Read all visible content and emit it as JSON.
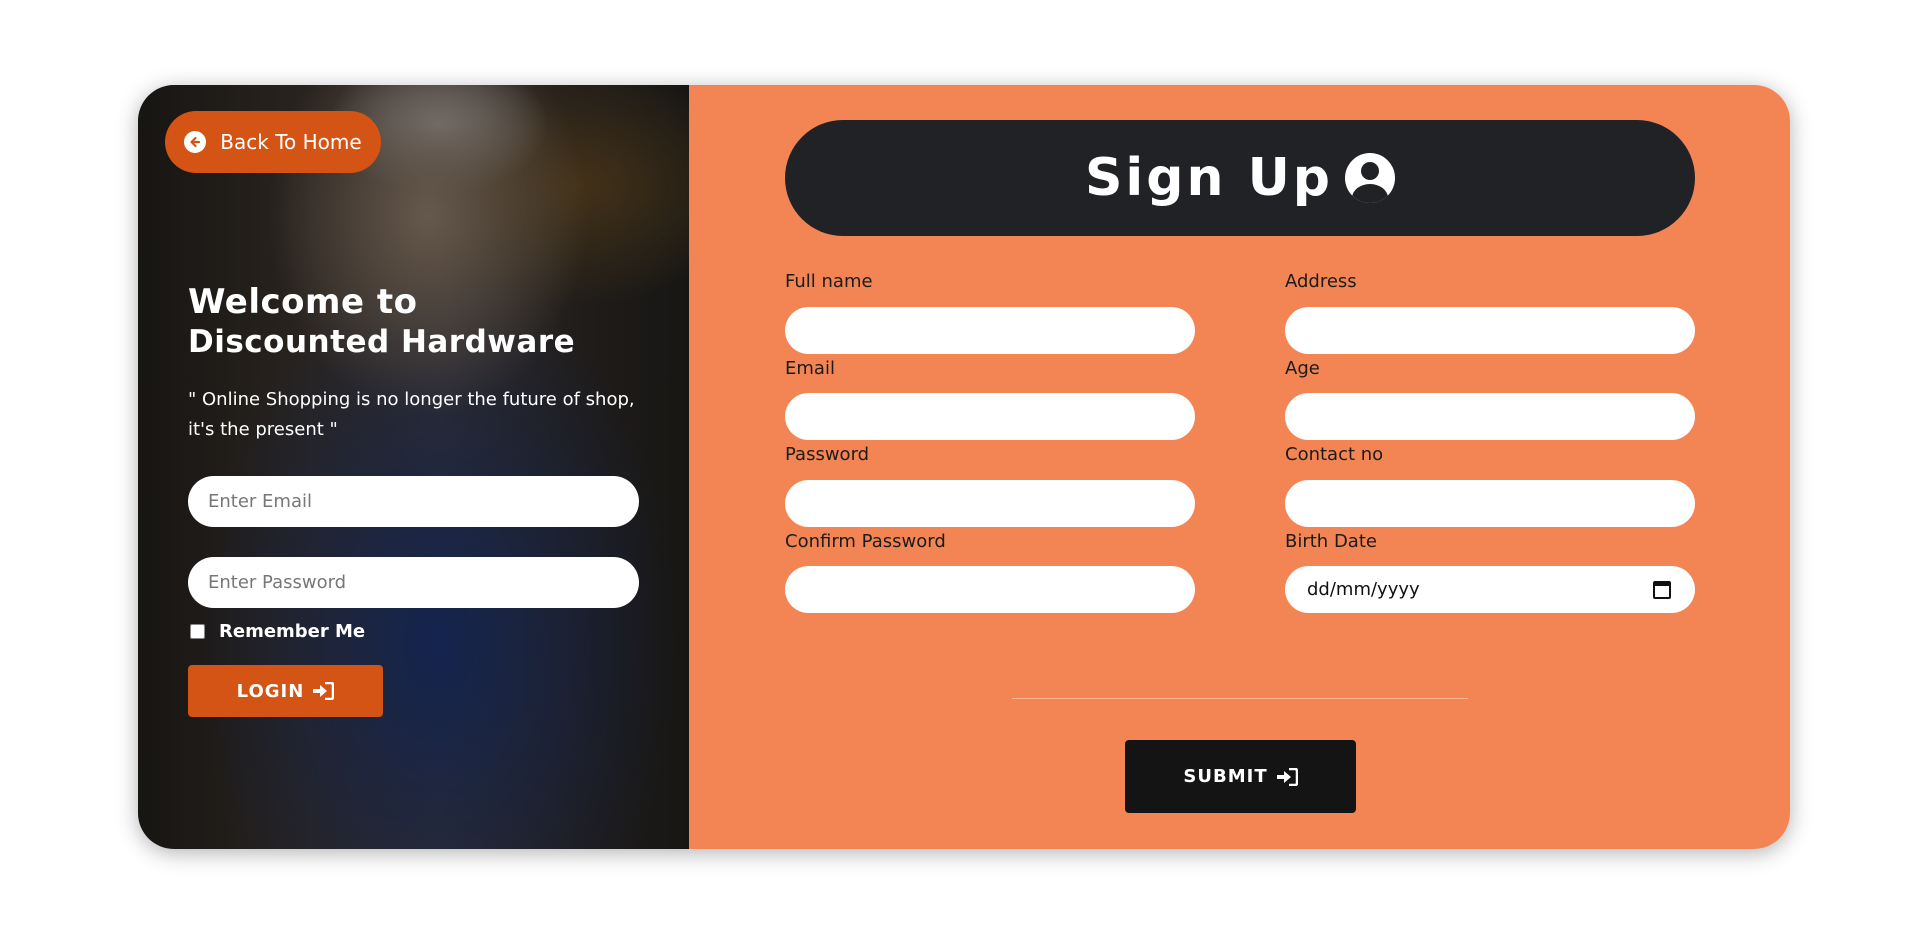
{
  "left_panel": {
    "back_button": {
      "label": "Back To Home",
      "icon": "arrow-circle-left-icon"
    },
    "welcome_line1": "Welcome to",
    "welcome_line2": "Discounted Hardware",
    "quote": "\" Online Shopping is no longer the future of shop, it's the present \"",
    "email_placeholder": "Enter Email",
    "password_placeholder": "Enter Password",
    "remember_label": "Remember Me",
    "login_label": "LOGIN",
    "login_icon": "sign-in-icon"
  },
  "signup": {
    "title": "Sign Up",
    "title_icon": "user-circle-icon",
    "fields": {
      "full_name": "Full name",
      "address": "Address",
      "email": "Email",
      "age": "Age",
      "password": "Password",
      "contact_no": "Contact no",
      "confirm_password": "Confirm Password",
      "birth_date": "Birth Date"
    },
    "birth_date_placeholder": "dd/mm/yyyy",
    "submit_label": "SUBMIT",
    "submit_icon": "sign-in-icon"
  },
  "colors": {
    "accent": "#d35414",
    "panel": "#f28553",
    "header": "#212226",
    "submit": "#141414"
  }
}
